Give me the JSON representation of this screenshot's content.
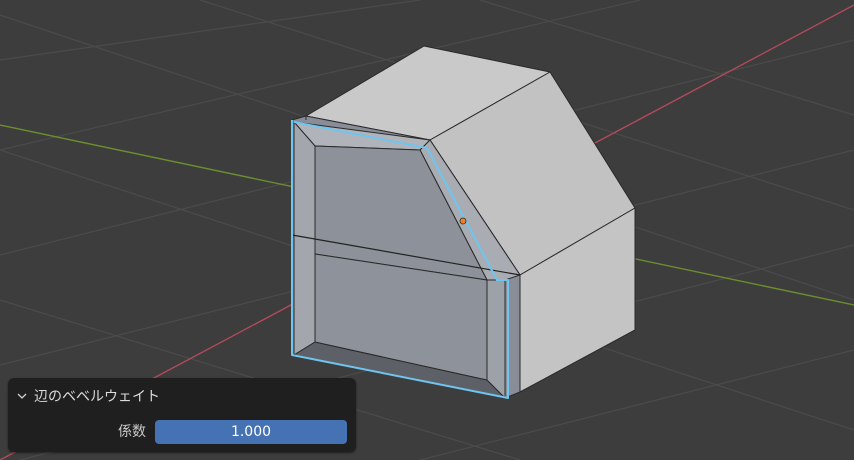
{
  "operator_panel": {
    "title": "辺のベベルウェイト",
    "factor_label": "係数",
    "factor_value": "1.000"
  },
  "icons": {
    "collapse": "chevron-down-icon",
    "origin": "object-origin-icon"
  },
  "colors": {
    "background": "#3d3d3d",
    "grid_line": "#4a4a4a",
    "x_axis": "#b34a5a",
    "y_axis": "#6b8e2e",
    "selection": "#6ec6f0",
    "origin_dot": "#f08020",
    "field_accent": "#4572b3",
    "panel_bg": "#1f1f1f"
  }
}
